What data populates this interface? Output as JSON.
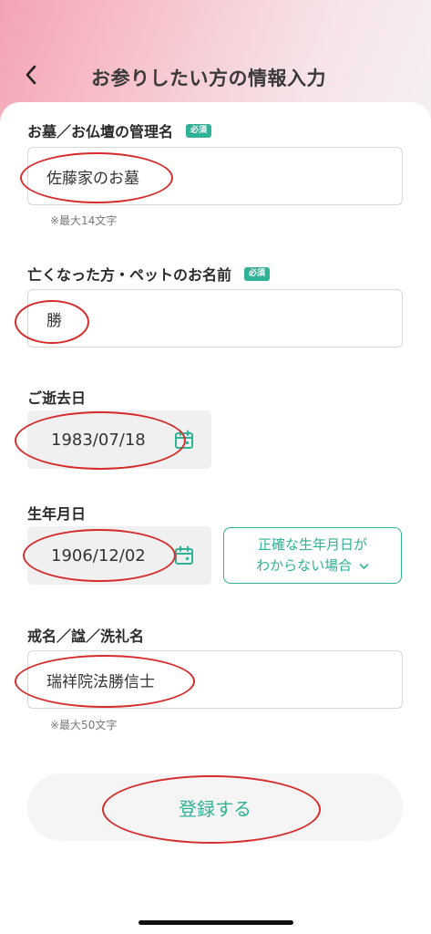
{
  "header": {
    "title": "お参りしたい方の情報入力"
  },
  "fields": {
    "grave_name": {
      "label": "お墓／お仏壇の管理名",
      "required": "必須",
      "value": "佐藤家のお墓",
      "hint": "※最大14文字"
    },
    "deceased_name": {
      "label": "亡くなった方・ペットのお名前",
      "required": "必須",
      "value": "勝"
    },
    "death_date": {
      "label": "ご逝去日",
      "value": "1983/07/18"
    },
    "birth_date": {
      "label": "生年月日",
      "value": "1906/12/02",
      "unknown_line1": "正確な生年月日が",
      "unknown_line2": "わからない場合"
    },
    "posthumous_name": {
      "label": "戒名／諡／洗礼名",
      "value": "瑞祥院法勝信士",
      "hint": "※最大50文字"
    }
  },
  "submit": {
    "label": "登録する"
  },
  "colors": {
    "accent": "#2fb295",
    "annotation": "#d62b2b"
  },
  "icons": [
    "chevron-left-icon",
    "calendar-icon",
    "chevron-down-icon"
  ]
}
